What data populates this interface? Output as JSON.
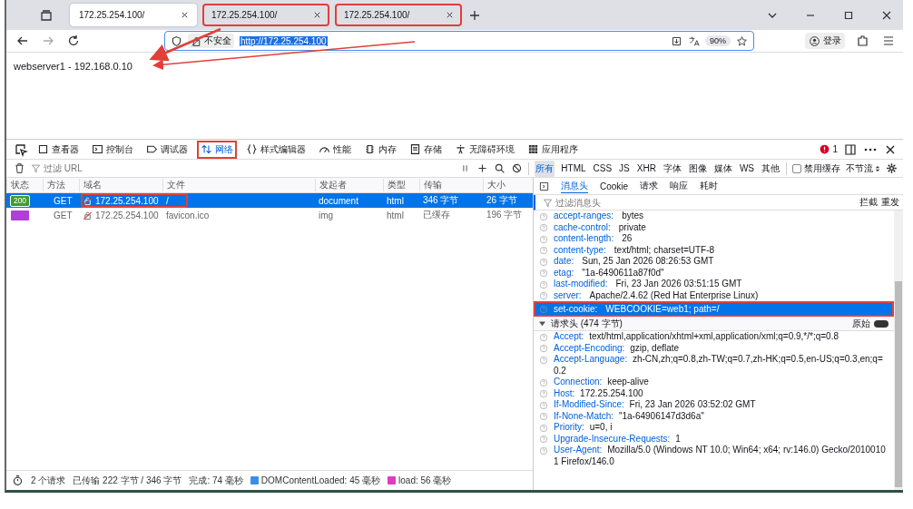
{
  "tabs": [
    {
      "title": "172.25.254.100/",
      "selected": true,
      "annotated": false
    },
    {
      "title": "172.25.254.100/",
      "selected": false,
      "annotated": true
    },
    {
      "title": "172.25.254.100/",
      "selected": false,
      "annotated": true
    }
  ],
  "navbar": {
    "security": "不安全",
    "url": "http://172.25.254.100",
    "zoom": "90%",
    "account": "登录"
  },
  "page_text": "webserver1 - 192.168.0.10",
  "devtools": {
    "tools": [
      {
        "label": "查看器",
        "selected": false,
        "annotated": false
      },
      {
        "label": "控制台",
        "selected": false,
        "annotated": false
      },
      {
        "label": "调试器",
        "selected": false,
        "annotated": false
      },
      {
        "label": "网络",
        "selected": true,
        "annotated": true
      },
      {
        "label": "样式编辑器",
        "selected": false,
        "annotated": false
      },
      {
        "label": "性能",
        "selected": false,
        "annotated": false
      },
      {
        "label": "内存",
        "selected": false,
        "annotated": false
      },
      {
        "label": "存储",
        "selected": false,
        "annotated": false
      },
      {
        "label": "无障碍环境",
        "selected": false,
        "annotated": false
      },
      {
        "label": "应用程序",
        "selected": false,
        "annotated": false
      }
    ],
    "error_count": "1",
    "filter_placeholder": "过滤 URL",
    "type_filters": [
      {
        "label": "所有",
        "selected": true
      },
      {
        "label": "HTML",
        "selected": false
      },
      {
        "label": "CSS",
        "selected": false
      },
      {
        "label": "JS",
        "selected": false
      },
      {
        "label": "XHR",
        "selected": false
      },
      {
        "label": "字体",
        "selected": false
      },
      {
        "label": "图像",
        "selected": false
      },
      {
        "label": "媒体",
        "selected": false
      },
      {
        "label": "WS",
        "selected": false
      },
      {
        "label": "其他",
        "selected": false
      }
    ],
    "disable_cache": {
      "label": "禁用缓存",
      "checked": false
    },
    "throttle": "不节流",
    "columns": [
      "状态",
      "方法",
      "域名",
      "文件",
      "发起者",
      "类型",
      "传输",
      "大小"
    ],
    "requests": [
      {
        "status": "200",
        "color": "#3f9b2f",
        "method": "GET",
        "domain": "172.25.254.100",
        "file": "/",
        "initiator": "document",
        "type": "html",
        "transferred": "346 字节",
        "size": "26 字节",
        "selected": true,
        "annotated": true
      },
      {
        "color": "#b03fd8",
        "method": "GET",
        "domain": "172.25.254.100",
        "file": "favicon.ico",
        "initiator": "img",
        "type": "html",
        "transferred": "已缓存",
        "size": "196 字节",
        "selected": false,
        "annotated": false
      }
    ],
    "detail_tabs": [
      {
        "label": "消息头",
        "selected": true
      },
      {
        "label": "Cookie",
        "selected": false
      },
      {
        "label": "请求",
        "selected": false
      },
      {
        "label": "响应",
        "selected": false
      },
      {
        "label": "耗时",
        "selected": false
      }
    ],
    "header_filter_placeholder": "过滤消息头",
    "header_actions": [
      "拦截",
      "重发"
    ],
    "response_headers": [
      {
        "name": "accept-ranges:",
        "value": "bytes",
        "selected": false,
        "annotated": false
      },
      {
        "name": "cache-control:",
        "value": "private",
        "selected": false,
        "annotated": false
      },
      {
        "name": "content-length:",
        "value": "26",
        "selected": false,
        "annotated": false
      },
      {
        "name": "content-type:",
        "value": "text/html; charset=UTF-8",
        "selected": false,
        "annotated": false
      },
      {
        "name": "date:",
        "value": "Sun, 25 Jan 2026 08:26:53 GMT",
        "selected": false,
        "annotated": false
      },
      {
        "name": "etag:",
        "value": "\"1a-6490611a87f0d\"",
        "selected": false,
        "annotated": false
      },
      {
        "name": "last-modified:",
        "value": "Fri, 23 Jan 2026 03:51:15 GMT",
        "selected": false,
        "annotated": false
      },
      {
        "name": "server:",
        "value": "Apache/2.4.62 (Red Hat Enterprise Linux)",
        "selected": false,
        "annotated": false
      },
      {
        "name": "set-cookie:",
        "value": "WEBCOOKIE=web1; path=/",
        "selected": true,
        "annotated": true
      }
    ],
    "request_section": {
      "title": "请求头 (474 字节)",
      "expanded": true,
      "raw_label": "原始",
      "raw_on": false
    },
    "request_headers": [
      {
        "name": "Accept:",
        "value": "text/html,application/xhtml+xml,application/xml;q=0.9,*/*;q=0.8"
      },
      {
        "name": "Accept-Encoding:",
        "value": "gzip, deflate"
      },
      {
        "name": "Accept-Language:",
        "value": "zh-CN,zh;q=0.8,zh-TW;q=0.7,zh-HK;q=0.5,en-US;q=0.3,en;q=0.2"
      },
      {
        "name": "Connection:",
        "value": "keep-alive"
      },
      {
        "name": "Host:",
        "value": "172.25.254.100"
      },
      {
        "name": "If-Modified-Since:",
        "value": "Fri, 23 Jan 2026 03:52:02 GMT"
      },
      {
        "name": "If-None-Match:",
        "value": "\"1a-64906147d3d6a\""
      },
      {
        "name": "Priority:",
        "value": "u=0, i"
      },
      {
        "name": "Upgrade-Insecure-Requests:",
        "value": "1"
      },
      {
        "name": "User-Agent:",
        "value": "Mozilla/5.0 (Windows NT 10.0; Win64; x64; rv:146.0) Gecko/20100101 Firefox/146.0"
      }
    ],
    "status_bar": {
      "requests": "2 个请求",
      "transferred": "已传输 222 字节 / 346 字节",
      "finish": "完成: 74 毫秒",
      "dcl": {
        "label": "DOMContentLoaded: 45 毫秒",
        "color": "#3b8fe8"
      },
      "load": {
        "label": "load: 56 毫秒",
        "color": "#e03cc0"
      }
    }
  }
}
